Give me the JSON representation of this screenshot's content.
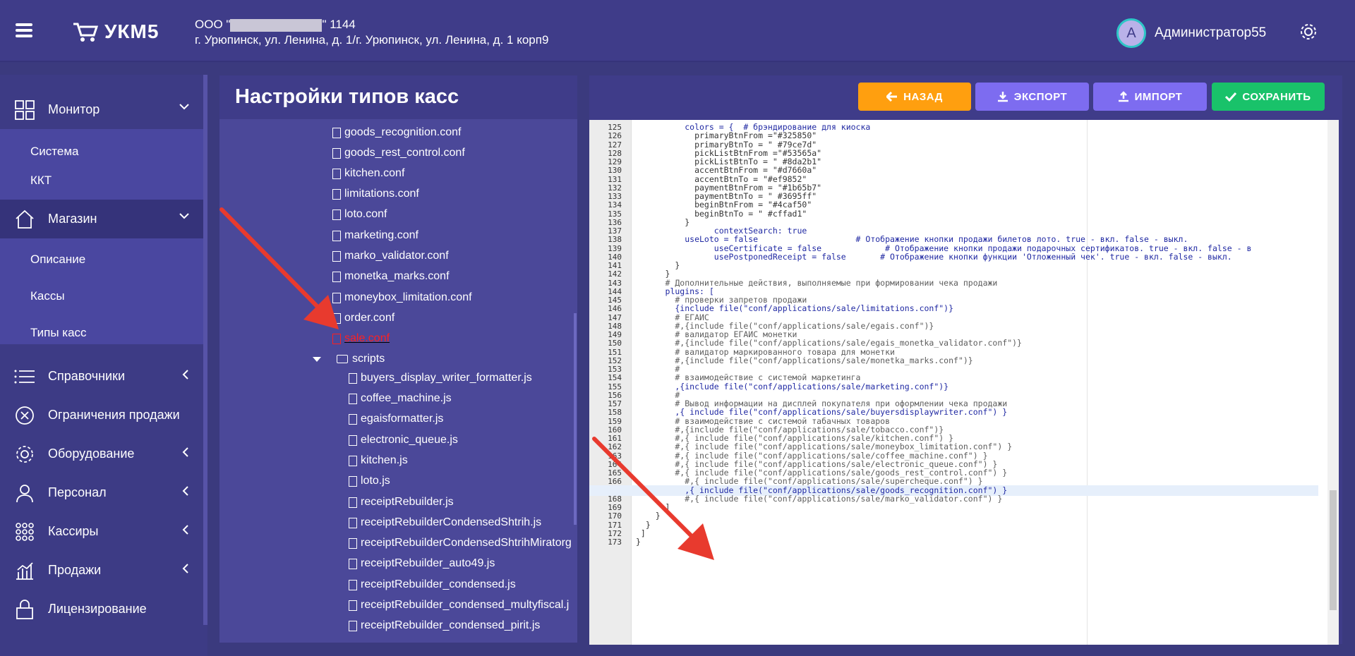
{
  "header": {
    "logo": "УКМ5",
    "org_prefix": "ООО \"",
    "org_suffix": "\" 1144",
    "address": "г. Урюпинск, ул. Ленина, д. 1/г. Урюпинск, ул. Ленина, д. 1 корп9",
    "avatar_letter": "A",
    "user_name": "Администратор55"
  },
  "sidebar": {
    "monitor": "Монитор",
    "monitor_sub": [
      "Система",
      "ККТ"
    ],
    "shop": "Магазин",
    "shop_sub": [
      "Описание",
      "Кассы",
      "Типы касс"
    ],
    "items": [
      "Справочники",
      "Ограничения продажи",
      "Оборудование",
      "Персонал",
      "Кассиры",
      "Продажи",
      "Лицензирование"
    ]
  },
  "page": {
    "title": "Настройки типов касс"
  },
  "tree": {
    "files": [
      "goods_recognition.conf",
      "goods_rest_control.conf",
      "kitchen.conf",
      "limitations.conf",
      "loto.conf",
      "marketing.conf",
      "marko_validator.conf",
      "monetka_marks.conf",
      "moneybox_limitation.conf",
      "order.conf",
      "sale.conf"
    ],
    "folder": "scripts",
    "scripts": [
      "buyers_display_writer_formatter.js",
      "coffee_machine.js",
      "egaisformatter.js",
      "electronic_queue.js",
      "kitchen.js",
      "loto.js",
      "receiptRebuilder.js",
      "receiptRebuilderCondensedShtrih.js",
      "receiptRebuilderCondensedShtrihMiratorg",
      "receiptRebuilder_auto49.js",
      "receiptRebuilder_condensed.js",
      "receiptRebuilder_condensed_multyfiscal.j",
      "receiptRebuilder_condensed_pirit.js"
    ]
  },
  "toolbar": {
    "back": "НАЗАД",
    "export": "ЭКСПОРТ",
    "import": "ИМПОРТ",
    "save": "СОХРАНИТЬ"
  },
  "colors": {
    "back": "#ff9f0f",
    "export": "#7d6cf0",
    "import": "#7d6cf0",
    "save": "#19c26a"
  },
  "editor": {
    "line_numbers": [
      "125",
      "126",
      "127",
      "128",
      "129",
      "130",
      "131",
      "132",
      "133",
      "134",
      "135",
      "136",
      "137",
      "138",
      "139",
      "140",
      "141",
      "142",
      "143",
      "144",
      "145",
      "146",
      "147",
      "148",
      "149",
      "150",
      "151",
      "152",
      "153",
      "154",
      "155",
      "156",
      "157",
      "158",
      "159",
      "160",
      "161",
      "162",
      "163",
      "164",
      "165",
      "166",
      "167",
      "168",
      "169",
      "170",
      "171",
      "172",
      "173"
    ],
    "lines": [
      "          colors = {  # брэндирование для киоска",
      "            primaryBtnFrom =\"#325850\"",
      "            primaryBtnTo = \" #79ce7d\"",
      "            pickListBtnFrom =\"#53565a\"",
      "            pickListBtnTo = \" #8da2b1\"",
      "            accentBtnFrom = \"#d7660a\"",
      "            accentBtnTo = \"#ef9852\"",
      "            paymentBtnFrom = \"#1b65b7\"",
      "            paymentBtnTo = \" #3695ff\"",
      "            beginBtnFrom = \"#4caf50\"",
      "            beginBtnTo = \" #cffad1\"",
      "          }",
      "                contextSearch: true",
      "          useLoto = false                    # Отображение кнопки продажи билетов лото. true - вкл. false - выкл.",
      "                useCertificate = false             # Отображение кнопки продажи подарочных сертификатов. true - вкл. false - в",
      "                usePostponedReceipt = false       # Отображение кнопки функции 'Отложенный чек'. true - вкл. false - выкл.",
      "        }",
      "      }",
      "      # Дополнительные действия, выполняемые при формировании чека продажи",
      "      plugins: [",
      "        # проверки запретов продажи",
      "        {include file(\"conf/applications/sale/limitations.conf\")}",
      "        # ЕГАИС",
      "        #,{include file(\"conf/applications/sale/egais.conf\")}",
      "        # валидатор ЕГАИС монетки",
      "        #,{include file(\"conf/applications/sale/egais_monetka_validator.conf\")}",
      "        # валидатор маркированного товара для монетки",
      "        #,{include file(\"conf/applications/sale/monetka_marks.conf\")}",
      "        #",
      "        # взаимодействие с системой маркетинга",
      "        ,{include file(\"conf/applications/sale/marketing.conf\")}",
      "        #",
      "        # Вывод информации на дисплей покупателя при оформлении чека продажи",
      "        ,{ include file(\"conf/applications/sale/buyersdisplaywriter.conf\") }",
      "        # взаимодействие с системой табачных товаров",
      "        #,{include file(\"conf/applications/sale/tobacco.conf\")}",
      "        #,{ include file(\"conf/applications/sale/kitchen.conf\") }",
      "        #,{ include file(\"conf/applications/sale/moneybox_limitation.conf\") }",
      "        #,{ include file(\"conf/applications/sale/coffee_machine.conf\") }",
      "        #,{ include file(\"conf/applications/sale/electronic_queue.conf\") }",
      "        #,{ include file(\"conf/applications/sale/goods_rest_control.conf\") }",
      "          #,{ include file(\"conf/applications/sale/supercheque.conf\") }",
      "          ,{ include file(\"conf/applications/sale/goods_recognition.conf\") }",
      "          #,{ include file(\"conf/applications/sale/marko_validator.conf\") }",
      "      ]",
      "    }",
      "  }",
      " ]",
      "}"
    ]
  }
}
